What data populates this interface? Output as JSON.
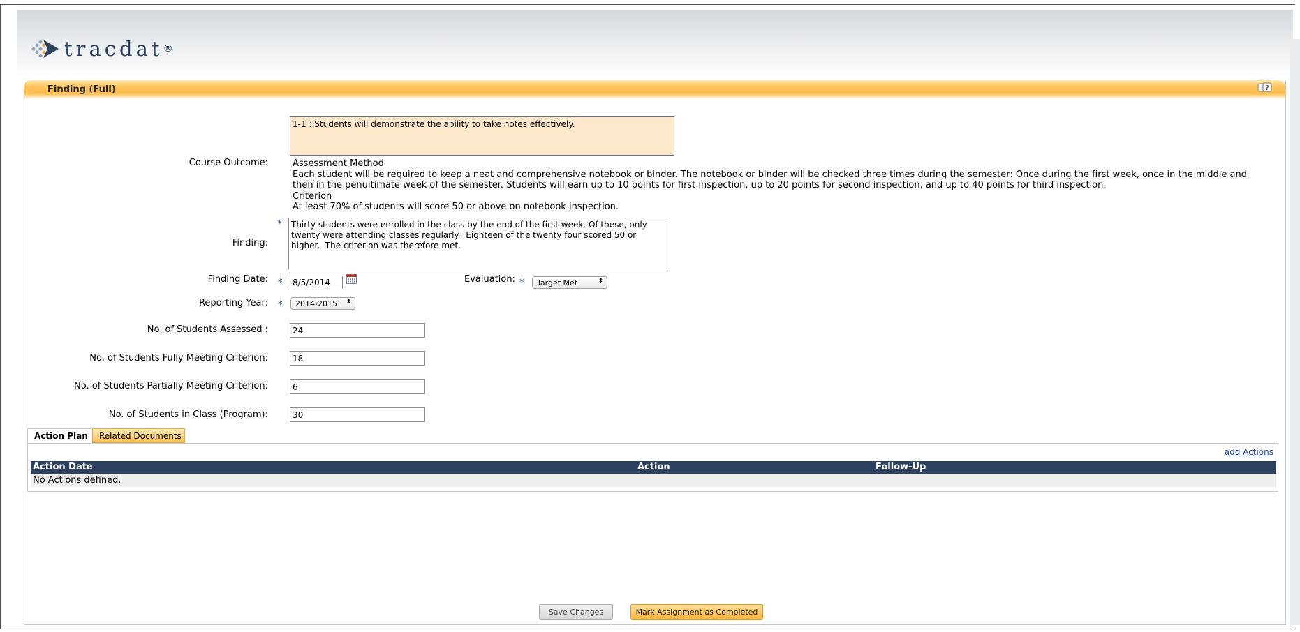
{
  "app": {
    "logo_text": "tracdat",
    "logo_dot": "®"
  },
  "page": {
    "title": "Finding (Full)"
  },
  "icons": {
    "help": "help-question-icon",
    "calendar": "calendar-icon",
    "logo_mark": "tracdat-diamond-logo"
  },
  "colors": {
    "title_bar": "#fbbb49",
    "table_header": "#2c4160",
    "outcome_box_bg": "#fde8cc",
    "link": "#1a3fa8"
  },
  "form": {
    "course_outcome_label": "Course Outcome:",
    "course_outcome_value": "1-1 : Students will demonstrate the ability to take notes effectively.",
    "assessment_method_heading": "Assessment Method",
    "assessment_method_text": "Each student will be required to keep a neat and comprehensive notebook or binder. The notebook or binder will be checked three times during the semester: Once during the first week, once in the middle and then in the penultimate week of the semester. Students will earn up to 10 points for first inspection, up to 20 points for second inspection, and up to 40 points for third inspection.",
    "criterion_heading": "Criterion",
    "criterion_text": "At least 70% of students will score 50 or above on notebook inspection.",
    "finding_label": "Finding:",
    "finding_value": "Thirty students were enrolled in the class by the end of the first week. Of these, only twenty were attending classes regularly.  Eighteen of the twenty four scored 50 or higher.  The criterion was therefore met.",
    "required_marker": "*",
    "finding_date_label": "Finding Date:",
    "finding_date_value": "8/5/2014",
    "evaluation_label": "Evaluation:",
    "evaluation_value": "Target Met",
    "reporting_year_label": "Reporting Year:",
    "reporting_year_value": "2014-2015",
    "students_assessed_label": "No. of Students Assessed :",
    "students_assessed_value": "24",
    "students_fully_label": "No. of Students Fully Meeting Criterion:",
    "students_fully_value": "18",
    "students_partially_label": "No. of Students Partially Meeting Criterion:",
    "students_partially_value": "6",
    "students_in_class_label": "No. of Students in Class (Program):",
    "students_in_class_value": "30"
  },
  "tabs": {
    "action_plan": "Action Plan",
    "related_documents": "Related Documents"
  },
  "action_plan": {
    "add_link": "add Actions",
    "columns": [
      "Action Date",
      "Action",
      "Follow-Up"
    ],
    "empty_text": "No Actions defined."
  },
  "buttons": {
    "save": "Save Changes",
    "complete": "Mark Assignment as Completed"
  }
}
